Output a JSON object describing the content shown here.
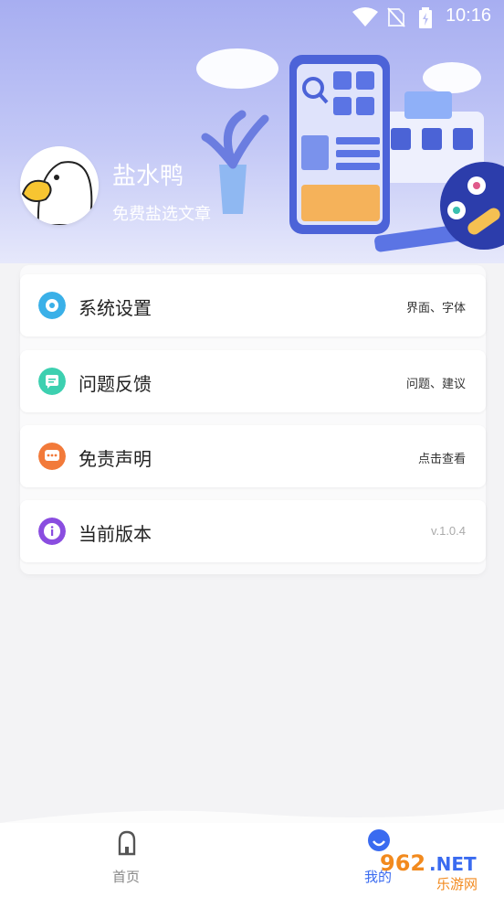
{
  "status_bar": {
    "time": "10:16"
  },
  "profile": {
    "nickname": "盐水鸭",
    "subtitle": "免费盐选文章"
  },
  "menu": [
    {
      "label": "系统设置",
      "hint": "界面、字体",
      "icon": "gear-icon",
      "color": "#3ab0e8"
    },
    {
      "label": "问题反馈",
      "hint": "问题、建议",
      "icon": "feedback-icon",
      "color": "#3dd0b0"
    },
    {
      "label": "免责声明",
      "hint": "点击查看",
      "icon": "chat-icon",
      "color": "#f27a3a"
    },
    {
      "label": "当前版本",
      "hint": "v.1.0.4",
      "icon": "info-icon",
      "color": "#8a4de0"
    }
  ],
  "tabbar": {
    "home_label": "首页",
    "me_label": "我的",
    "active_color": "#3a6bf0",
    "inactive_color": "#888888"
  },
  "watermark": {
    "text_top": "962.NET",
    "text_bottom": "乐游网"
  }
}
